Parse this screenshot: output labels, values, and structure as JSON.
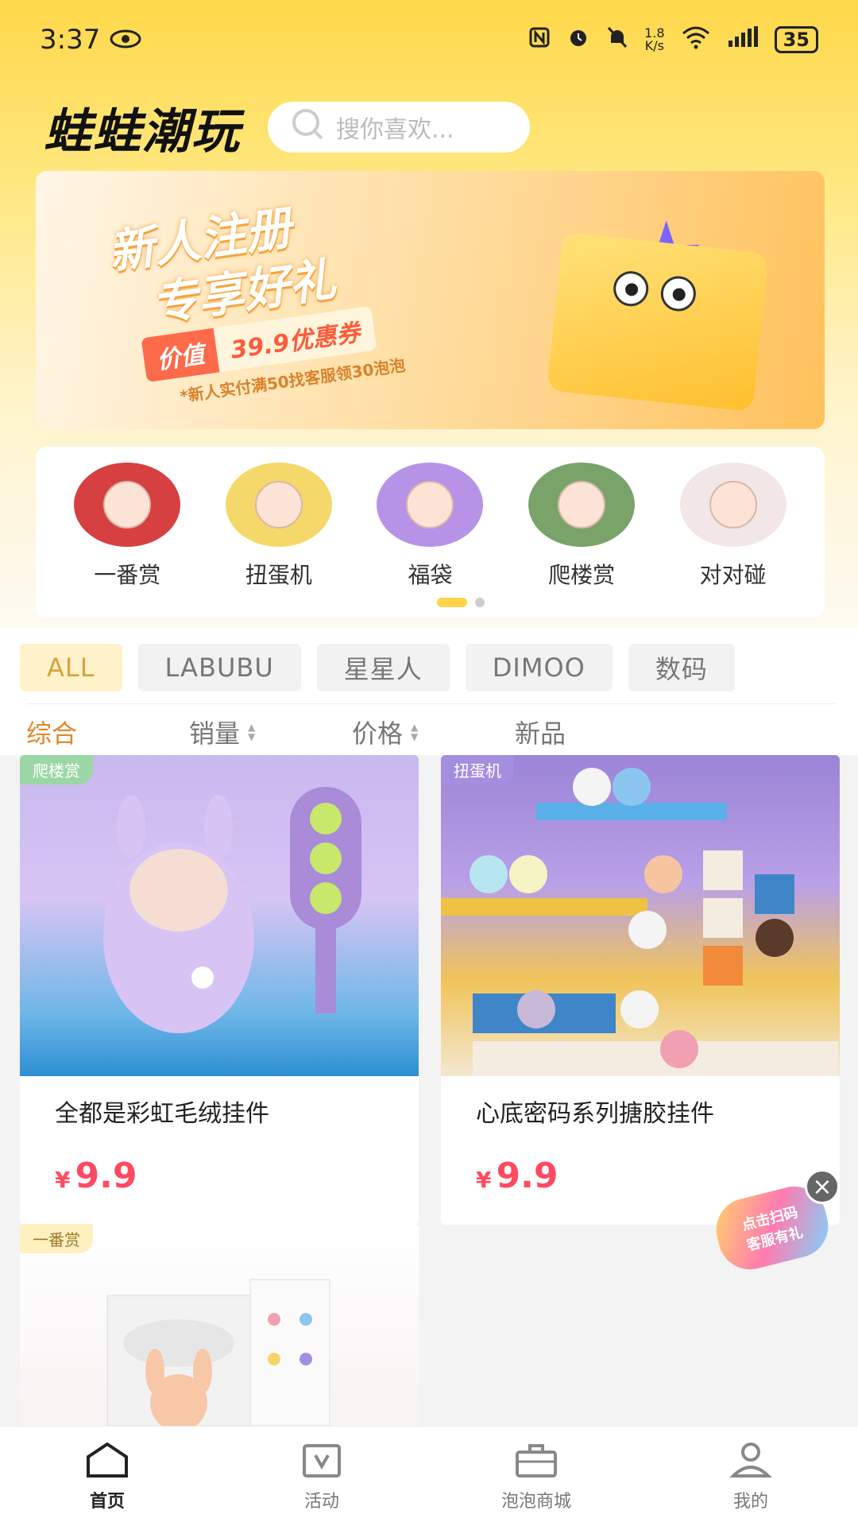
{
  "status_bar": {
    "time": "3:37",
    "net_speed_value": "1.8",
    "net_speed_unit": "K/s",
    "battery": "35"
  },
  "header": {
    "app_title": "蛙蛙潮玩",
    "search_placeholder": "搜你喜欢..."
  },
  "banner": {
    "title_line1": "新人注册",
    "title_line2": "专享好礼",
    "coupon_label": "价值",
    "coupon_value": "39.9优惠券",
    "note": "*新人实付满50找客服领30泡泡"
  },
  "categories": [
    {
      "label": "一番赏",
      "color": "#d64040"
    },
    {
      "label": "扭蛋机",
      "color": "#f5d86a"
    },
    {
      "label": "福袋",
      "color": "#b793e8"
    },
    {
      "label": "爬楼赏",
      "color": "#7aa36a"
    },
    {
      "label": "对对碰",
      "color": "#f2e6e6"
    }
  ],
  "filter_tags": [
    "ALL",
    "LABUBU",
    "星星人",
    "DIMOO",
    "数码"
  ],
  "sort_options": [
    "综合",
    "销量",
    "价格",
    "新品"
  ],
  "products": [
    {
      "tag": "爬楼赏",
      "tag_color": "#9bd7a6",
      "name": "全都是彩虹毛绒挂件",
      "currency": "¥",
      "price": "9.9"
    },
    {
      "tag": "扭蛋机",
      "tag_color": "#a38ee0",
      "name": "心底密码系列搪胶挂件",
      "currency": "¥",
      "price": "9.9"
    },
    {
      "tag": "一番赏",
      "tag_color": "#fff0c0",
      "name": "",
      "currency": "",
      "price": ""
    }
  ],
  "float_badge": {
    "line1": "点击扫码",
    "line2": "客服有礼"
  },
  "bottom_nav": [
    "首页",
    "活动",
    "泡泡商城",
    "我的"
  ],
  "colors": {
    "accent_yellow": "#ffd84a",
    "price_red": "#ff4a62",
    "sort_active": "#e08a2e"
  }
}
